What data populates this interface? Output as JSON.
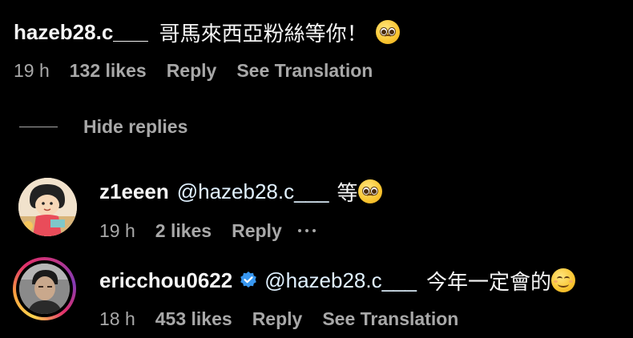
{
  "comment": {
    "username": "hazeb28.c___",
    "text": "哥馬來西亞粉絲等你！",
    "emoji": "pleading-face-emoji",
    "time": "19 h",
    "likes": "132 likes",
    "reply_label": "Reply",
    "translate_label": "See Translation"
  },
  "hide_replies_label": "Hide replies",
  "replies": [
    {
      "username": "z1eeen",
      "mention": "@hazeb28.c___",
      "text": "等",
      "emoji": "pleading-face-emoji",
      "time": "19 h",
      "likes": "2 likes",
      "reply_label": "Reply",
      "more_icon": "more-dots-icon"
    },
    {
      "username": "ericchou0622",
      "verified_icon": "verified-badge-icon",
      "mention": "@hazeb28.c___",
      "text": "今年一定會的",
      "emoji": "smiling-face-emoji",
      "time": "18 h",
      "likes": "453 likes",
      "reply_label": "Reply",
      "translate_label": "See Translation"
    }
  ],
  "colors": {
    "background": "#000000",
    "primary_text": "#f5f5f5",
    "secondary_text": "#a8a8a8",
    "mention": "#e0f1ff",
    "verified": "#3897f0"
  }
}
